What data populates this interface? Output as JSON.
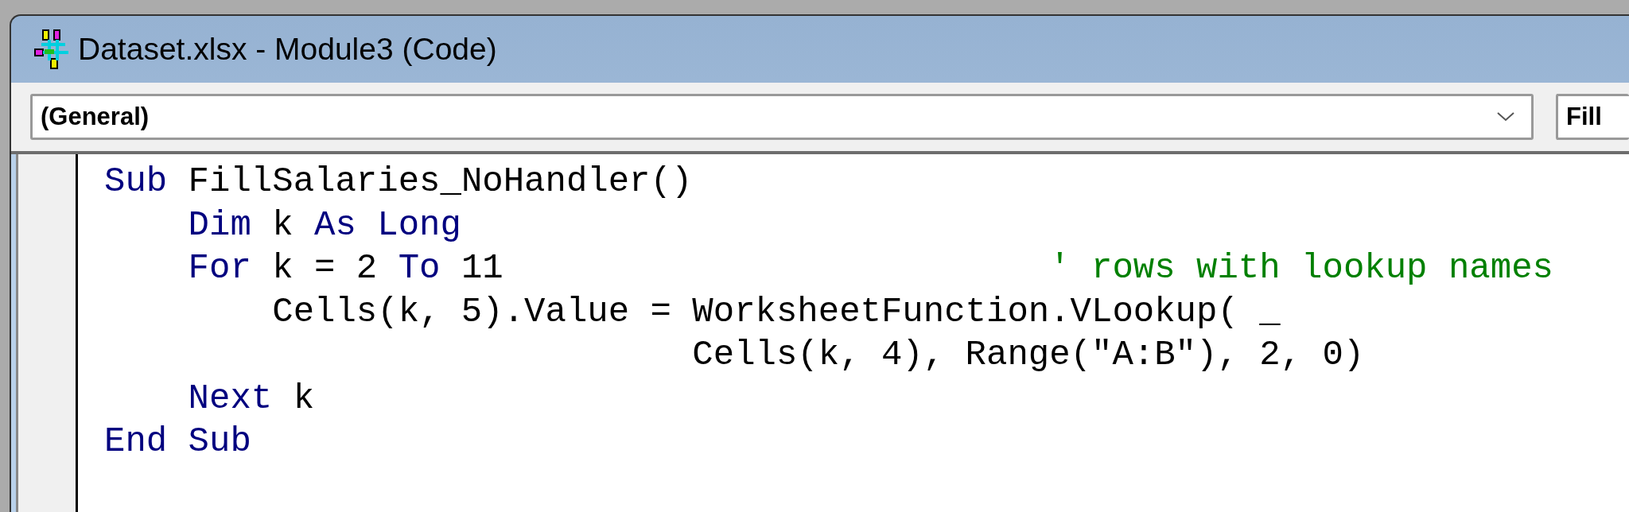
{
  "window": {
    "title": "Dataset.xlsx - Module3 (Code)"
  },
  "object_dropdown": {
    "value": "(General)"
  },
  "procedure_dropdown": {
    "value": "Fill"
  },
  "code_lines": [
    [
      {
        "kind": "keyword",
        "text": "Sub"
      },
      {
        "kind": "plain",
        "text": " FillSalaries_NoHandler()"
      }
    ],
    [
      {
        "kind": "keyword",
        "text": "    Dim"
      },
      {
        "kind": "plain",
        "text": " k "
      },
      {
        "kind": "keyword",
        "text": "As Long"
      }
    ],
    [
      {
        "kind": "keyword",
        "text": "    For"
      },
      {
        "kind": "plain",
        "text": " k = 2 "
      },
      {
        "kind": "keyword",
        "text": "To"
      },
      {
        "kind": "plain",
        "text": " 11"
      },
      {
        "kind": "comment",
        "text": "                          ' rows with lookup names"
      }
    ],
    [
      {
        "kind": "plain",
        "text": "        Cells(k, 5).Value = WorksheetFunction.VLookup( _"
      }
    ],
    [
      {
        "kind": "plain",
        "text": "                            Cells(k, 4), Range(\"A:B\"), 2, 0)"
      }
    ],
    [
      {
        "kind": "keyword",
        "text": "    Next"
      },
      {
        "kind": "plain",
        "text": " k"
      }
    ],
    [
      {
        "kind": "keyword",
        "text": "End Sub"
      }
    ]
  ]
}
